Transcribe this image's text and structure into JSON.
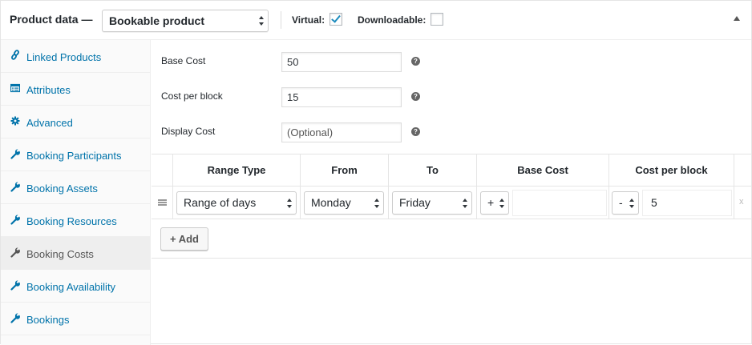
{
  "header": {
    "title": "Product data —",
    "product_type": "Bookable product",
    "virtual_label": "Virtual:",
    "virtual_checked": true,
    "downloadable_label": "Downloadable:",
    "downloadable_checked": false,
    "collapse_icon": "triangle-up-icon"
  },
  "sidebar": {
    "items": [
      {
        "label": "Linked Products",
        "icon": "link-icon",
        "active": false
      },
      {
        "label": "Attributes",
        "icon": "list-icon",
        "active": false
      },
      {
        "label": "Advanced",
        "icon": "gear-icon",
        "active": false
      },
      {
        "label": "Booking Participants",
        "icon": "wrench-icon",
        "active": false
      },
      {
        "label": "Booking Assets",
        "icon": "wrench-icon",
        "active": false
      },
      {
        "label": "Booking Resources",
        "icon": "wrench-icon",
        "active": false
      },
      {
        "label": "Booking Costs",
        "icon": "wrench-icon",
        "active": true
      },
      {
        "label": "Booking Availability",
        "icon": "wrench-icon",
        "active": false
      },
      {
        "label": "Bookings",
        "icon": "wrench-icon",
        "active": false
      }
    ]
  },
  "fields": {
    "base_cost": {
      "label": "Base Cost",
      "value": "50"
    },
    "cost_per_block": {
      "label": "Cost per block",
      "value": "15"
    },
    "display_cost": {
      "label": "Display Cost",
      "placeholder": "(Optional)"
    }
  },
  "table": {
    "headers": [
      "Range Type",
      "From",
      "To",
      "Base Cost",
      "Cost per block"
    ],
    "row": {
      "range_type": "Range of days",
      "from": "Monday",
      "to": "Friday",
      "base_modifier": "+",
      "base_cost": "",
      "block_modifier": "-",
      "block_cost": "5",
      "remove": "x"
    },
    "add_label": "+ Add"
  },
  "colors": {
    "link": "#0073aa",
    "active_text": "#555555",
    "checkmark": "#1e8cbe"
  }
}
